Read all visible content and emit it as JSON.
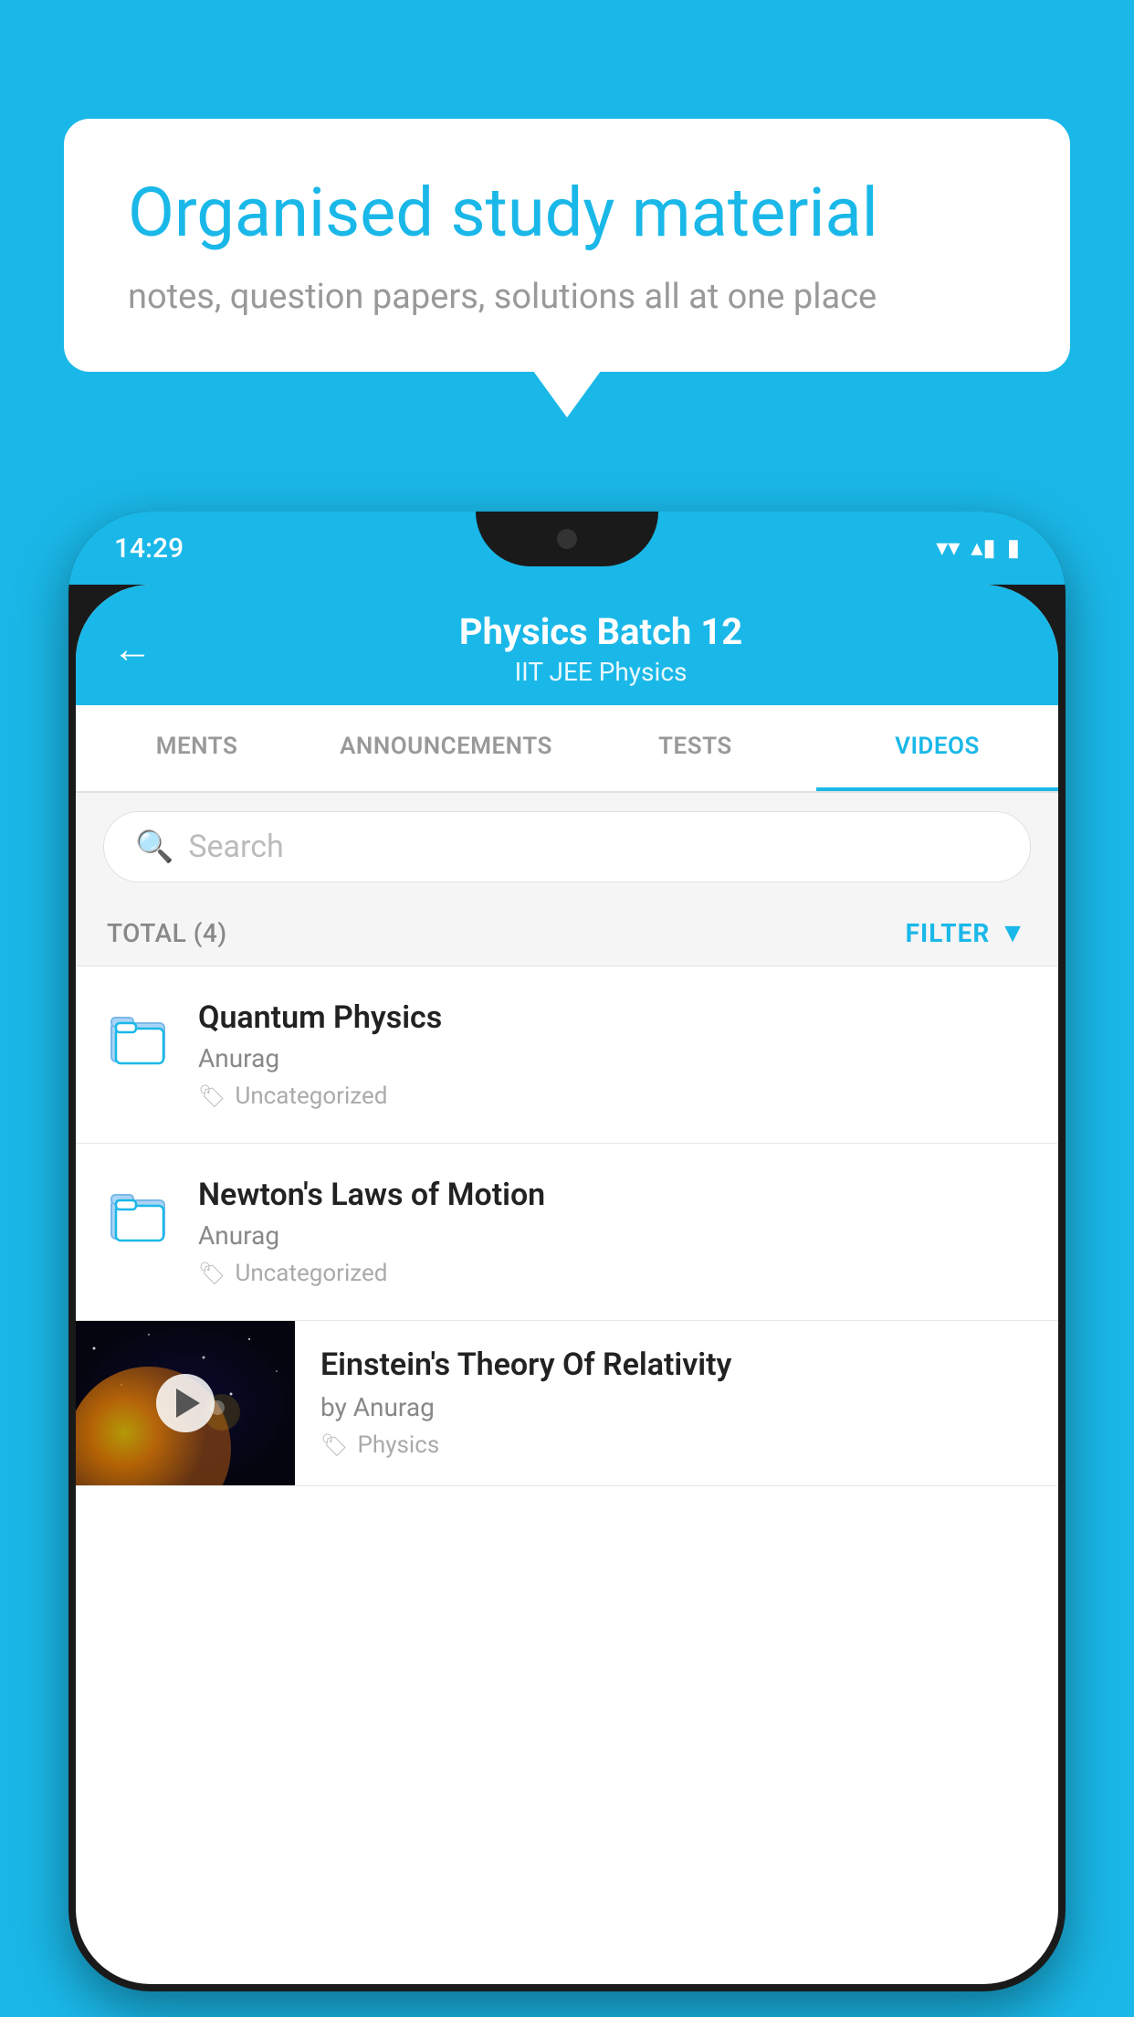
{
  "background_color": "#1ab8e8",
  "speech_bubble": {
    "title": "Organised study material",
    "subtitle": "notes, question papers, solutions all at one place"
  },
  "phone": {
    "status_bar": {
      "time": "14:29",
      "wifi": "▾",
      "signal": "▴",
      "battery": "▮"
    },
    "header": {
      "back_label": "←",
      "title": "Physics Batch 12",
      "subtitle": "IIT JEE    Physics"
    },
    "tabs": [
      {
        "label": "MENTS",
        "active": false
      },
      {
        "label": "ANNOUNCEMENTS",
        "active": false
      },
      {
        "label": "TESTS",
        "active": false
      },
      {
        "label": "VIDEOS",
        "active": true
      }
    ],
    "search": {
      "placeholder": "Search"
    },
    "filter": {
      "total_label": "TOTAL (4)",
      "filter_label": "FILTER"
    },
    "videos": [
      {
        "title": "Quantum Physics",
        "author": "Anurag",
        "tag": "Uncategorized",
        "has_thumbnail": false
      },
      {
        "title": "Newton's Laws of Motion",
        "author": "Anurag",
        "tag": "Uncategorized",
        "has_thumbnail": false
      },
      {
        "title": "Einstein's Theory Of Relativity",
        "author": "by Anurag",
        "tag": "Physics",
        "has_thumbnail": true
      }
    ]
  }
}
